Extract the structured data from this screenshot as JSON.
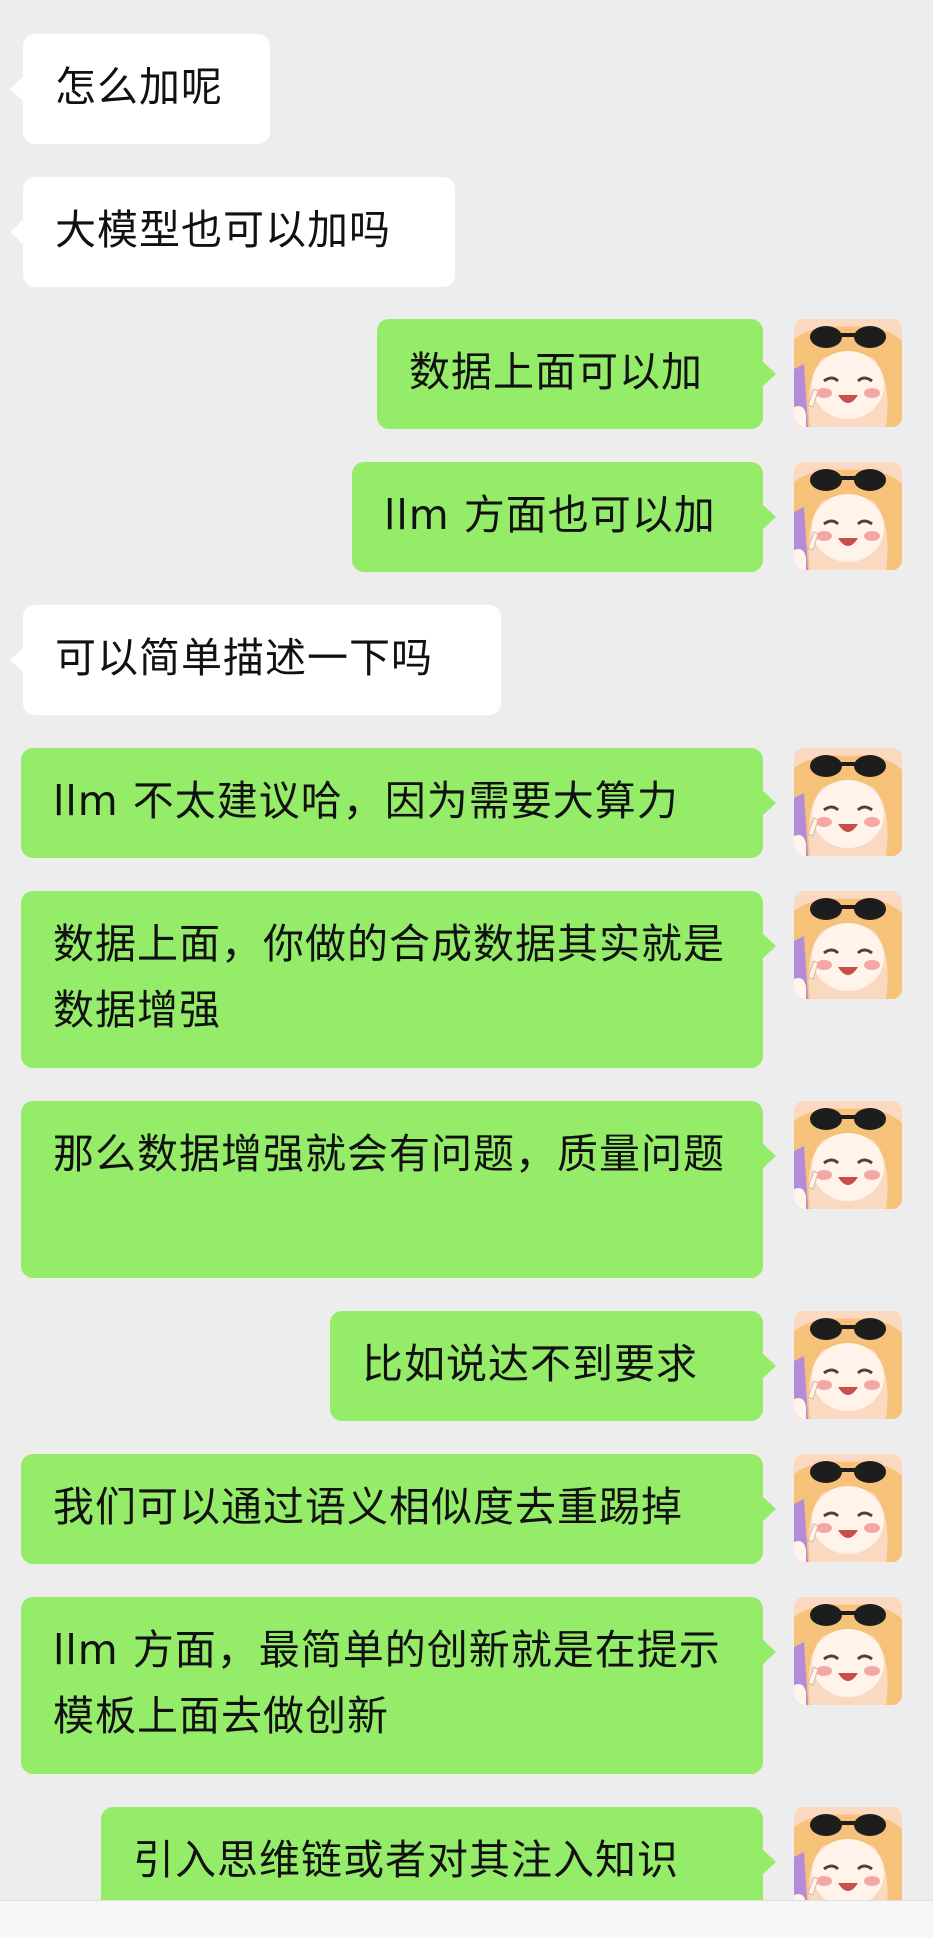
{
  "colors": {
    "background": "#ededed",
    "incoming_bubble": "#ffffff",
    "outgoing_bubble": "#95ec69",
    "text": "#111111"
  },
  "avatar": {
    "icon": "anime-girl-sunglasses-avatar"
  },
  "messages": [
    {
      "side": "left",
      "text": "怎么加呢"
    },
    {
      "side": "left",
      "text": "大模型也可以加吗"
    },
    {
      "side": "right",
      "text": "数据上面可以加"
    },
    {
      "side": "right",
      "text": "llm 方面也可以加"
    },
    {
      "side": "left",
      "text": "可以简单描述一下吗"
    },
    {
      "side": "right",
      "text": "llm 不太建议哈，因为需要大算力"
    },
    {
      "side": "right",
      "text": "数据上面，你做的合成数据其实就是数据增强"
    },
    {
      "side": "right",
      "text": "那么数据增强就会有问题，质量问题"
    },
    {
      "side": "right",
      "text": "比如说达不到要求"
    },
    {
      "side": "right",
      "text": "我们可以通过语义相似度去重踢掉"
    },
    {
      "side": "right",
      "text": "llm 方面，最简单的创新就是在提示模板上面去做创新"
    },
    {
      "side": "right",
      "text": "引入思维链或者对其注入知识"
    }
  ]
}
